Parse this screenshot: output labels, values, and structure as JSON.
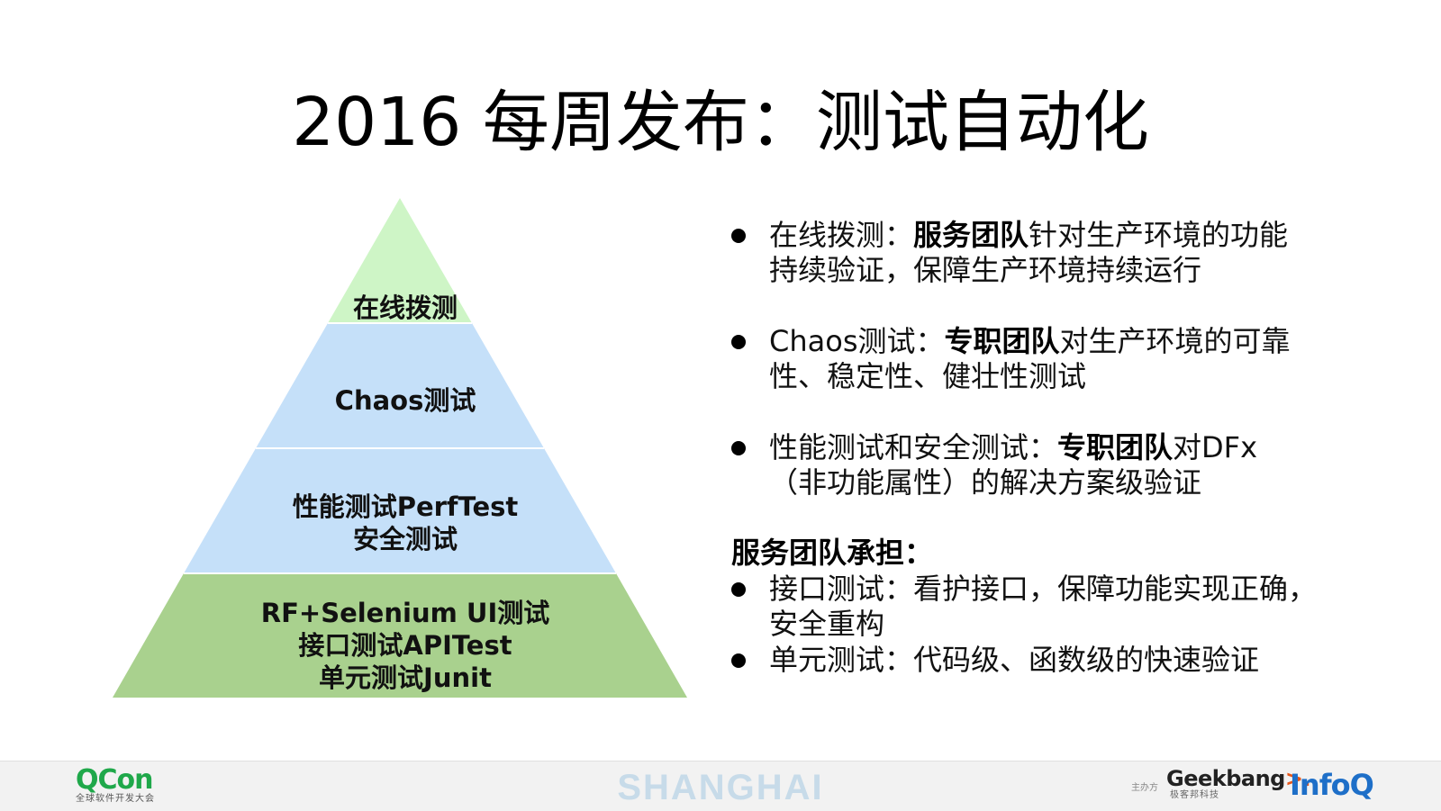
{
  "title": "2016 每周发布：测试自动化",
  "pyramid": {
    "levels": [
      {
        "lines": [
          "在线拨测"
        ],
        "color": "#cef5c6"
      },
      {
        "lines": [
          "Chaos测试"
        ],
        "color": "#c5e0f9"
      },
      {
        "lines": [
          "性能测试PerfTest",
          "安全测试"
        ],
        "color": "#c5e0f9"
      },
      {
        "lines": [
          "RF+Selenium UI测试",
          "接口测试APITest",
          "单元测试Junit"
        ],
        "color": "#a9d18e"
      }
    ]
  },
  "bullets_top": [
    {
      "line1_pre": "在线拨测：",
      "line1_bold": "服务团队",
      "line1_post": "针对生产环境的功能",
      "line2": "持续验证，保障生产环境持续运行"
    },
    {
      "line1_pre": "Chaos测试：",
      "line1_bold": "专职团队",
      "line1_post": "对生产环境的可靠",
      "line2": "性、稳定性、健壮性测试"
    },
    {
      "line1_pre": "性能测试和安全测试：",
      "line1_bold": "专职团队",
      "line1_post": "对DFx",
      "line2": "（非功能属性）的解决方案级验证"
    }
  ],
  "section_head": "服务团队承担：",
  "bullets_bottom": [
    {
      "line1": "接口测试：看护接口，保障功能实现正确，",
      "line2": "安全重构"
    },
    {
      "line1": "单元测试：代码级、函数级的快速验证"
    }
  ],
  "footer": {
    "qcon_logo": "QCon",
    "qcon_sub": "全球软件开发大会",
    "city": "SHANGHAI",
    "sponsor_label": "主办方",
    "geek_logo_main": "Geekbang",
    "geek_logo_accent": ">.",
    "geek_sub": "极客邦科技",
    "infoq": "InfoQ"
  }
}
